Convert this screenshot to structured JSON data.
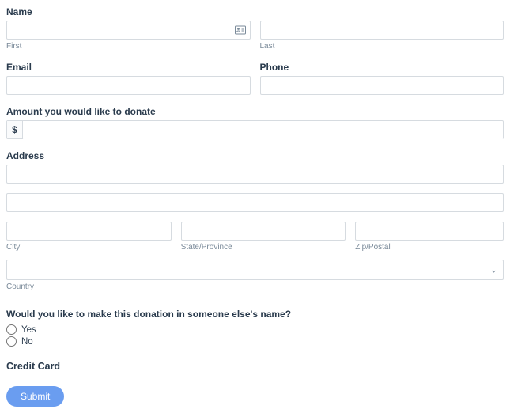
{
  "name": {
    "label": "Name",
    "first_sub": "First",
    "last_sub": "Last"
  },
  "email": {
    "label": "Email"
  },
  "phone": {
    "label": "Phone"
  },
  "amount": {
    "label": "Amount you would like to donate",
    "currency": "$"
  },
  "address": {
    "label": "Address",
    "city_sub": "City",
    "state_sub": "State/Province",
    "zip_sub": "Zip/Postal",
    "country_sub": "Country"
  },
  "honor": {
    "question": "Would you like to make this donation in someone else's name?",
    "yes": "Yes",
    "no": "No"
  },
  "credit": {
    "label": "Credit Card"
  },
  "submit": {
    "label": "Submit"
  }
}
